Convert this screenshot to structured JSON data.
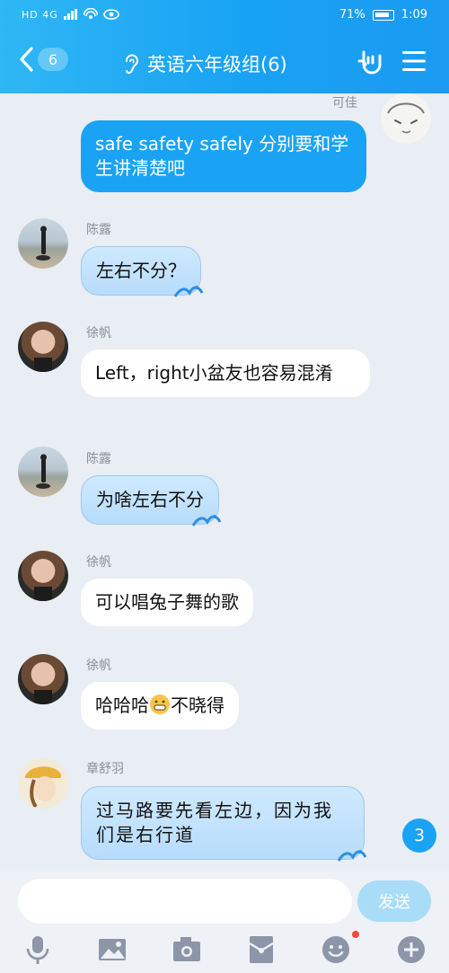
{
  "status_bar": {
    "signal_text": "HD 4G",
    "battery_percent": "71%",
    "time": "1:09"
  },
  "header": {
    "back_count": "6",
    "title": "英语六年级组(6)"
  },
  "messages": [
    {
      "sender": "可佳",
      "text": "safe safety safely  分别要和学生讲清楚吧",
      "side": "right"
    },
    {
      "sender": "陈露",
      "text": "左右不分？",
      "side": "left"
    },
    {
      "sender": "徐帆",
      "text": "Left，right小盆友也容易混淆",
      "side": "left"
    },
    {
      "sender": "陈露",
      "text": "为啥左右不分",
      "side": "left"
    },
    {
      "sender": "徐帆",
      "text": "可以唱兔子舞的歌",
      "side": "left"
    },
    {
      "sender": "徐帆",
      "text_before": "哈哈哈",
      "text_after": "不晓得",
      "side": "left"
    },
    {
      "sender": "章舒羽",
      "text": "过马路要先看左边，因为我们是右行道",
      "side": "left"
    }
  ],
  "unread_badge": "3",
  "input": {
    "value": "",
    "placeholder": "",
    "send_label": "发送"
  },
  "colors": {
    "header_blue": "#1aa3f4",
    "my_bubble": "#1aa3f4",
    "notification_dot": "#f2473a"
  },
  "toolbar_icons": [
    "microphone-icon",
    "image-icon",
    "camera-icon",
    "red-packet-icon",
    "emoji-icon",
    "plus-icon"
  ]
}
